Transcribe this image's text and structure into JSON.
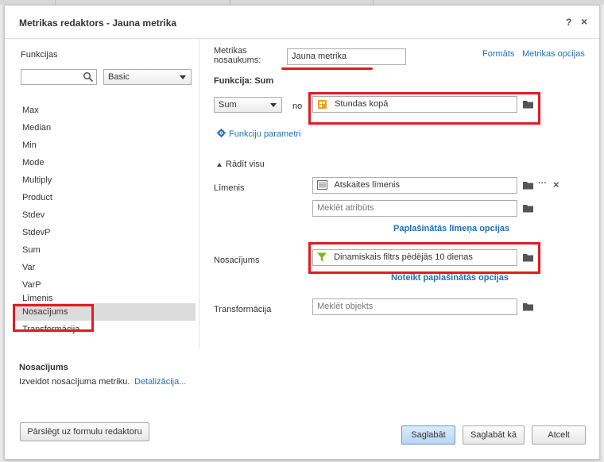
{
  "dialog": {
    "title": "Metrikas redaktors - Jauna metrika",
    "help_label": "?",
    "close_label": "×"
  },
  "left": {
    "functions_label": "Funkcijas",
    "search_value": "",
    "category_selected": "Basic",
    "functions": [
      "Max",
      "Median",
      "Min",
      "Mode",
      "Multiply",
      "Product",
      "Stdev",
      "StdevP",
      "Sum",
      "Var",
      "VarP",
      "Līmenis",
      "Nosacījums",
      "Transformācija"
    ],
    "selected_function": "Nosacījums"
  },
  "metric": {
    "name_label_line1": "Metrikas",
    "name_label_line2": "nosaukums:",
    "name_value": "Jauna metrika",
    "formats_link": "Formāts",
    "options_link": "Metrikas opcijas",
    "function_heading": "Funkcija: Sum",
    "function_select": "Sum",
    "no_label": "no",
    "fact_value": "Stundas kopā",
    "params_link": "Funkciju parametri",
    "show_all": "Rādīt visu"
  },
  "level": {
    "label": "Līmenis",
    "value": "Atskaites līmenis",
    "more_label": "···",
    "remove_label": "×",
    "search_placeholder": "Meklēt atribūts",
    "advanced_link": "Paplašinātās līmeņa opcijas"
  },
  "condition": {
    "label": "Nosacījums",
    "value": "Dinamiskais filtrs pēdējās 10 dienas",
    "advanced_link": "Noteikt paplašinātās opcijas"
  },
  "transformation": {
    "label": "Transformācija",
    "search_placeholder": "Meklēt objekts"
  },
  "description": {
    "title": "Nosacījums",
    "text": "Izveidot nosacījuma metriku.",
    "details_link": "Detalizācija..."
  },
  "footer": {
    "switch_button": "Pārslēgt uz formulu redaktoru",
    "save_button": "Saglabāt",
    "save_as_button": "Saglabāt kā",
    "cancel_button": "Atcelt"
  },
  "colors": {
    "link": "#1f6fb8",
    "highlight": "#e11b22",
    "primary_button": "#b7d5f3",
    "fact_icon": "#f0a020",
    "filter_icon": "#7ab51d"
  }
}
